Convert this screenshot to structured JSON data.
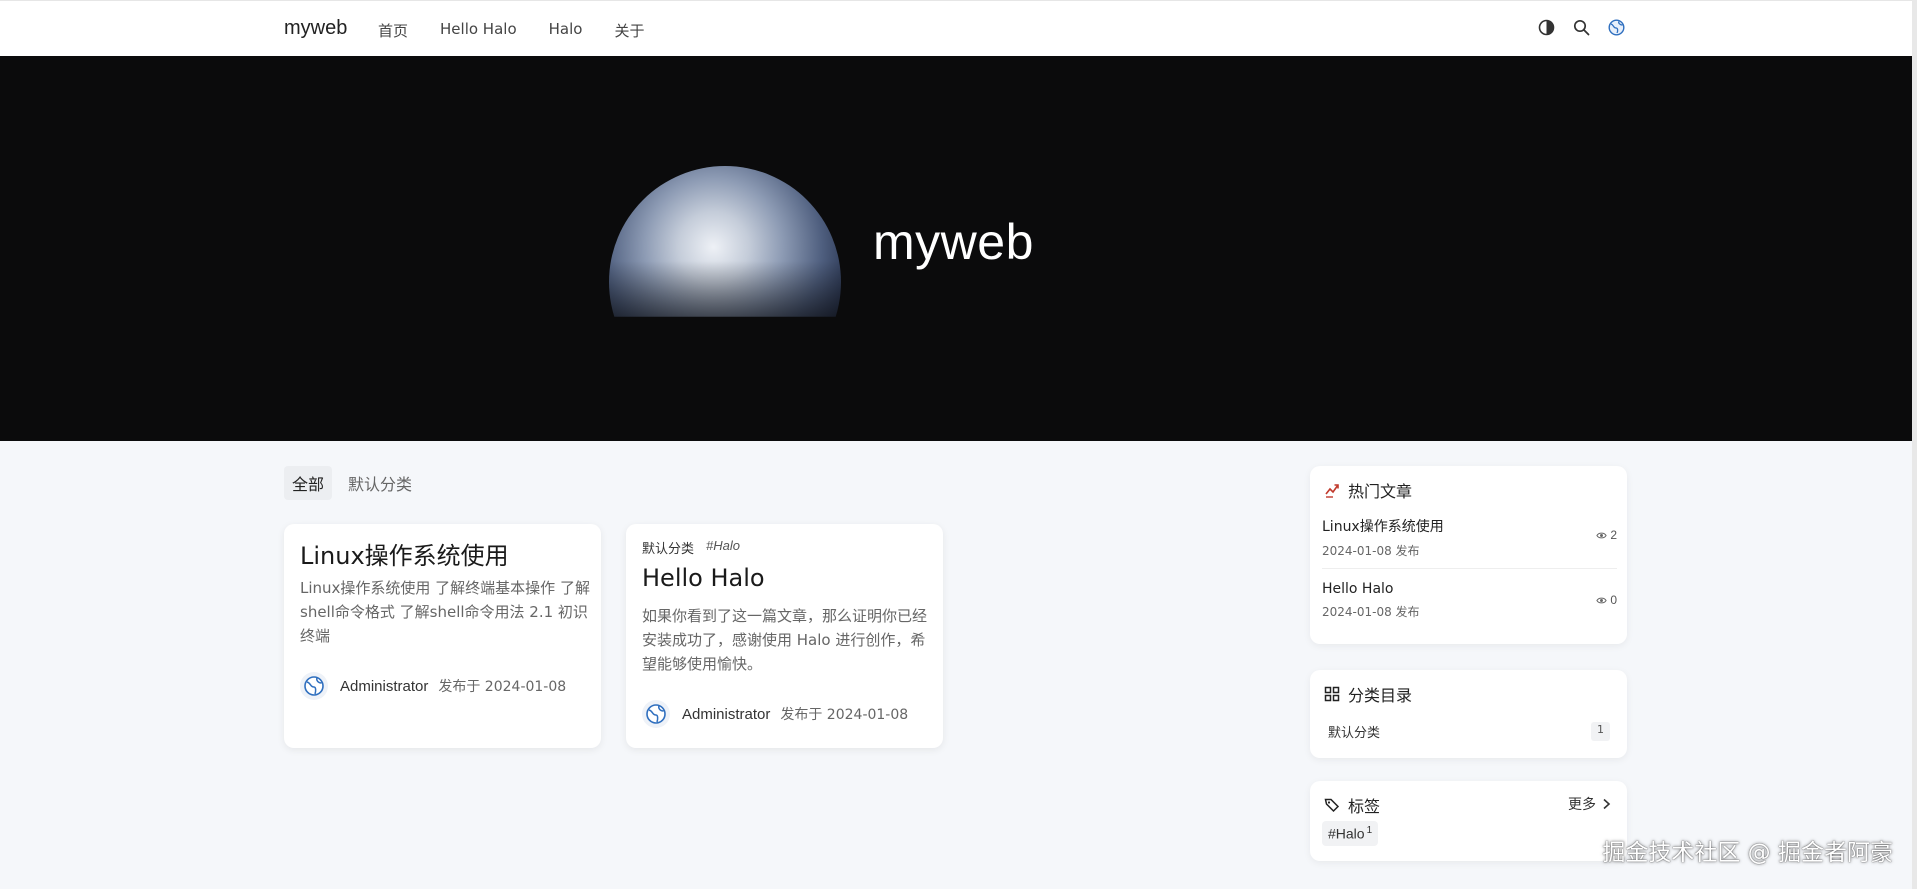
{
  "header": {
    "brand": "myweb",
    "nav": [
      "首页",
      "Hello Halo",
      "Halo",
      "关于"
    ],
    "icons": [
      "theme-toggle-icon",
      "search-icon",
      "globe-avatar-icon"
    ]
  },
  "hero": {
    "title": "myweb"
  },
  "filter_tabs": [
    "全部",
    "默认分类"
  ],
  "posts": [
    {
      "title": "Linux操作系统使用",
      "excerpt": "Linux操作系统使用 了解终端基本操作 了解shell命令格式 了解shell命令用法 2.1 初识终端",
      "author": "Administrator",
      "date": "发布于 2024-01-08"
    },
    {
      "category": "默认分类",
      "tag": "#Halo",
      "title": "Hello Halo",
      "excerpt": "如果你看到了这一篇文章，那么证明你已经安装成功了，感谢使用 Halo 进行创作，希望能够使用愉快。",
      "author": "Administrator",
      "date": "发布于 2024-01-08"
    }
  ],
  "sidebar": {
    "hot": {
      "title": "热门文章",
      "items": [
        {
          "title": "Linux操作系统使用",
          "date": "2024-01-08 发布",
          "views": "2"
        },
        {
          "title": "Hello Halo",
          "date": "2024-01-08 发布",
          "views": "0"
        }
      ]
    },
    "categories": {
      "title": "分类目录",
      "items": [
        {
          "name": "默认分类",
          "count": "1"
        }
      ]
    },
    "tags": {
      "title": "标签",
      "more": "更多",
      "items": [
        {
          "name": "#Halo",
          "count": "1"
        }
      ]
    }
  },
  "watermark": "掘金技术社区 @ 掘金者阿豪",
  "colors": {
    "hero_bg": "#0b0b0c",
    "page_bg": "#f5f7fa",
    "hot_icon": "#c0392b",
    "avatar_blue": "#2f6fbf"
  }
}
